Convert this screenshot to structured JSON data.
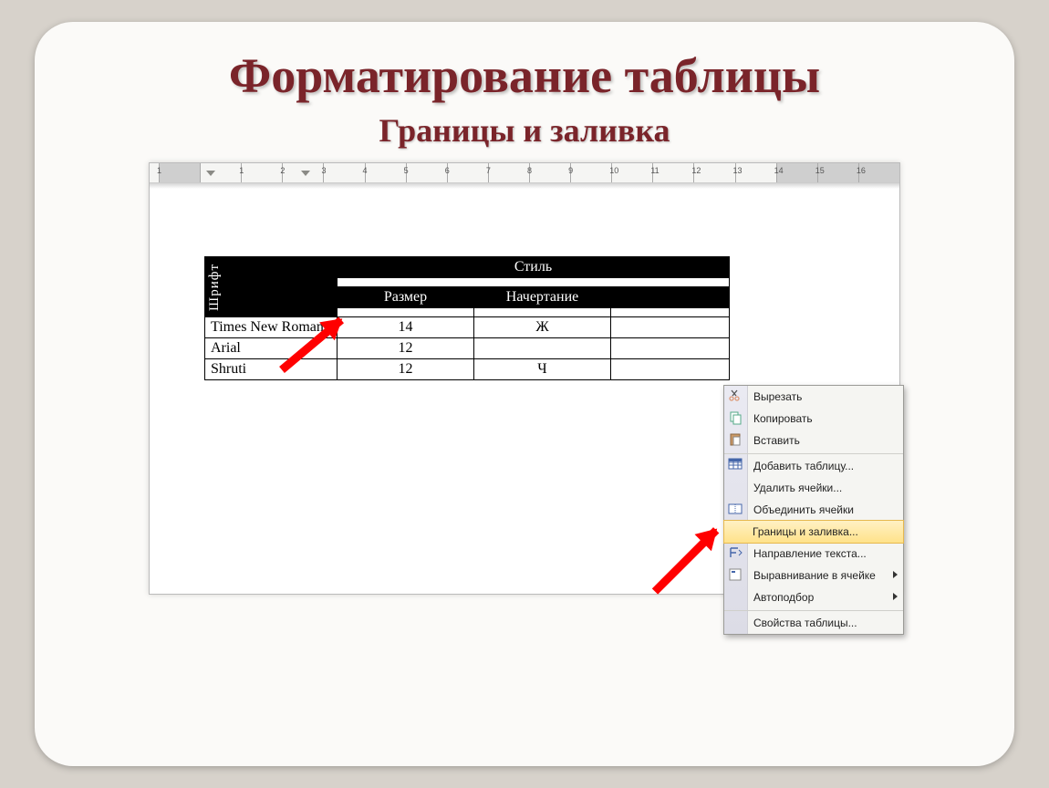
{
  "title": "Форматирование таблицы",
  "subtitle": "Границы и заливка",
  "ruler": [
    "1",
    "",
    "1",
    "2",
    "3",
    "4",
    "5",
    "6",
    "7",
    "8",
    "9",
    "10",
    "11",
    "12",
    "13",
    "14",
    "15",
    "16"
  ],
  "table": {
    "font_vertical": "Шрифт",
    "style_header": "Стиль",
    "col_size": "Размер",
    "col_face": "Начертание",
    "rows": [
      {
        "name": "Times New Roman",
        "size": "14",
        "face": "Ж"
      },
      {
        "name": "Arial",
        "size": "12",
        "face": ""
      },
      {
        "name": "Shruti",
        "size": "12",
        "face": "Ч"
      }
    ]
  },
  "context_menu": {
    "cut": "Вырезать",
    "copy": "Копировать",
    "paste": "Вставить",
    "insert_table": "Добавить таблицу...",
    "delete_cells": "Удалить ячейки...",
    "merge_cells": "Объединить ячейки",
    "borders_shading": "Границы и заливка...",
    "text_direction": "Направление текста...",
    "cell_alignment": "Выравнивание в ячейке",
    "autofit": "Автоподбор",
    "table_props": "Свойства таблицы..."
  }
}
